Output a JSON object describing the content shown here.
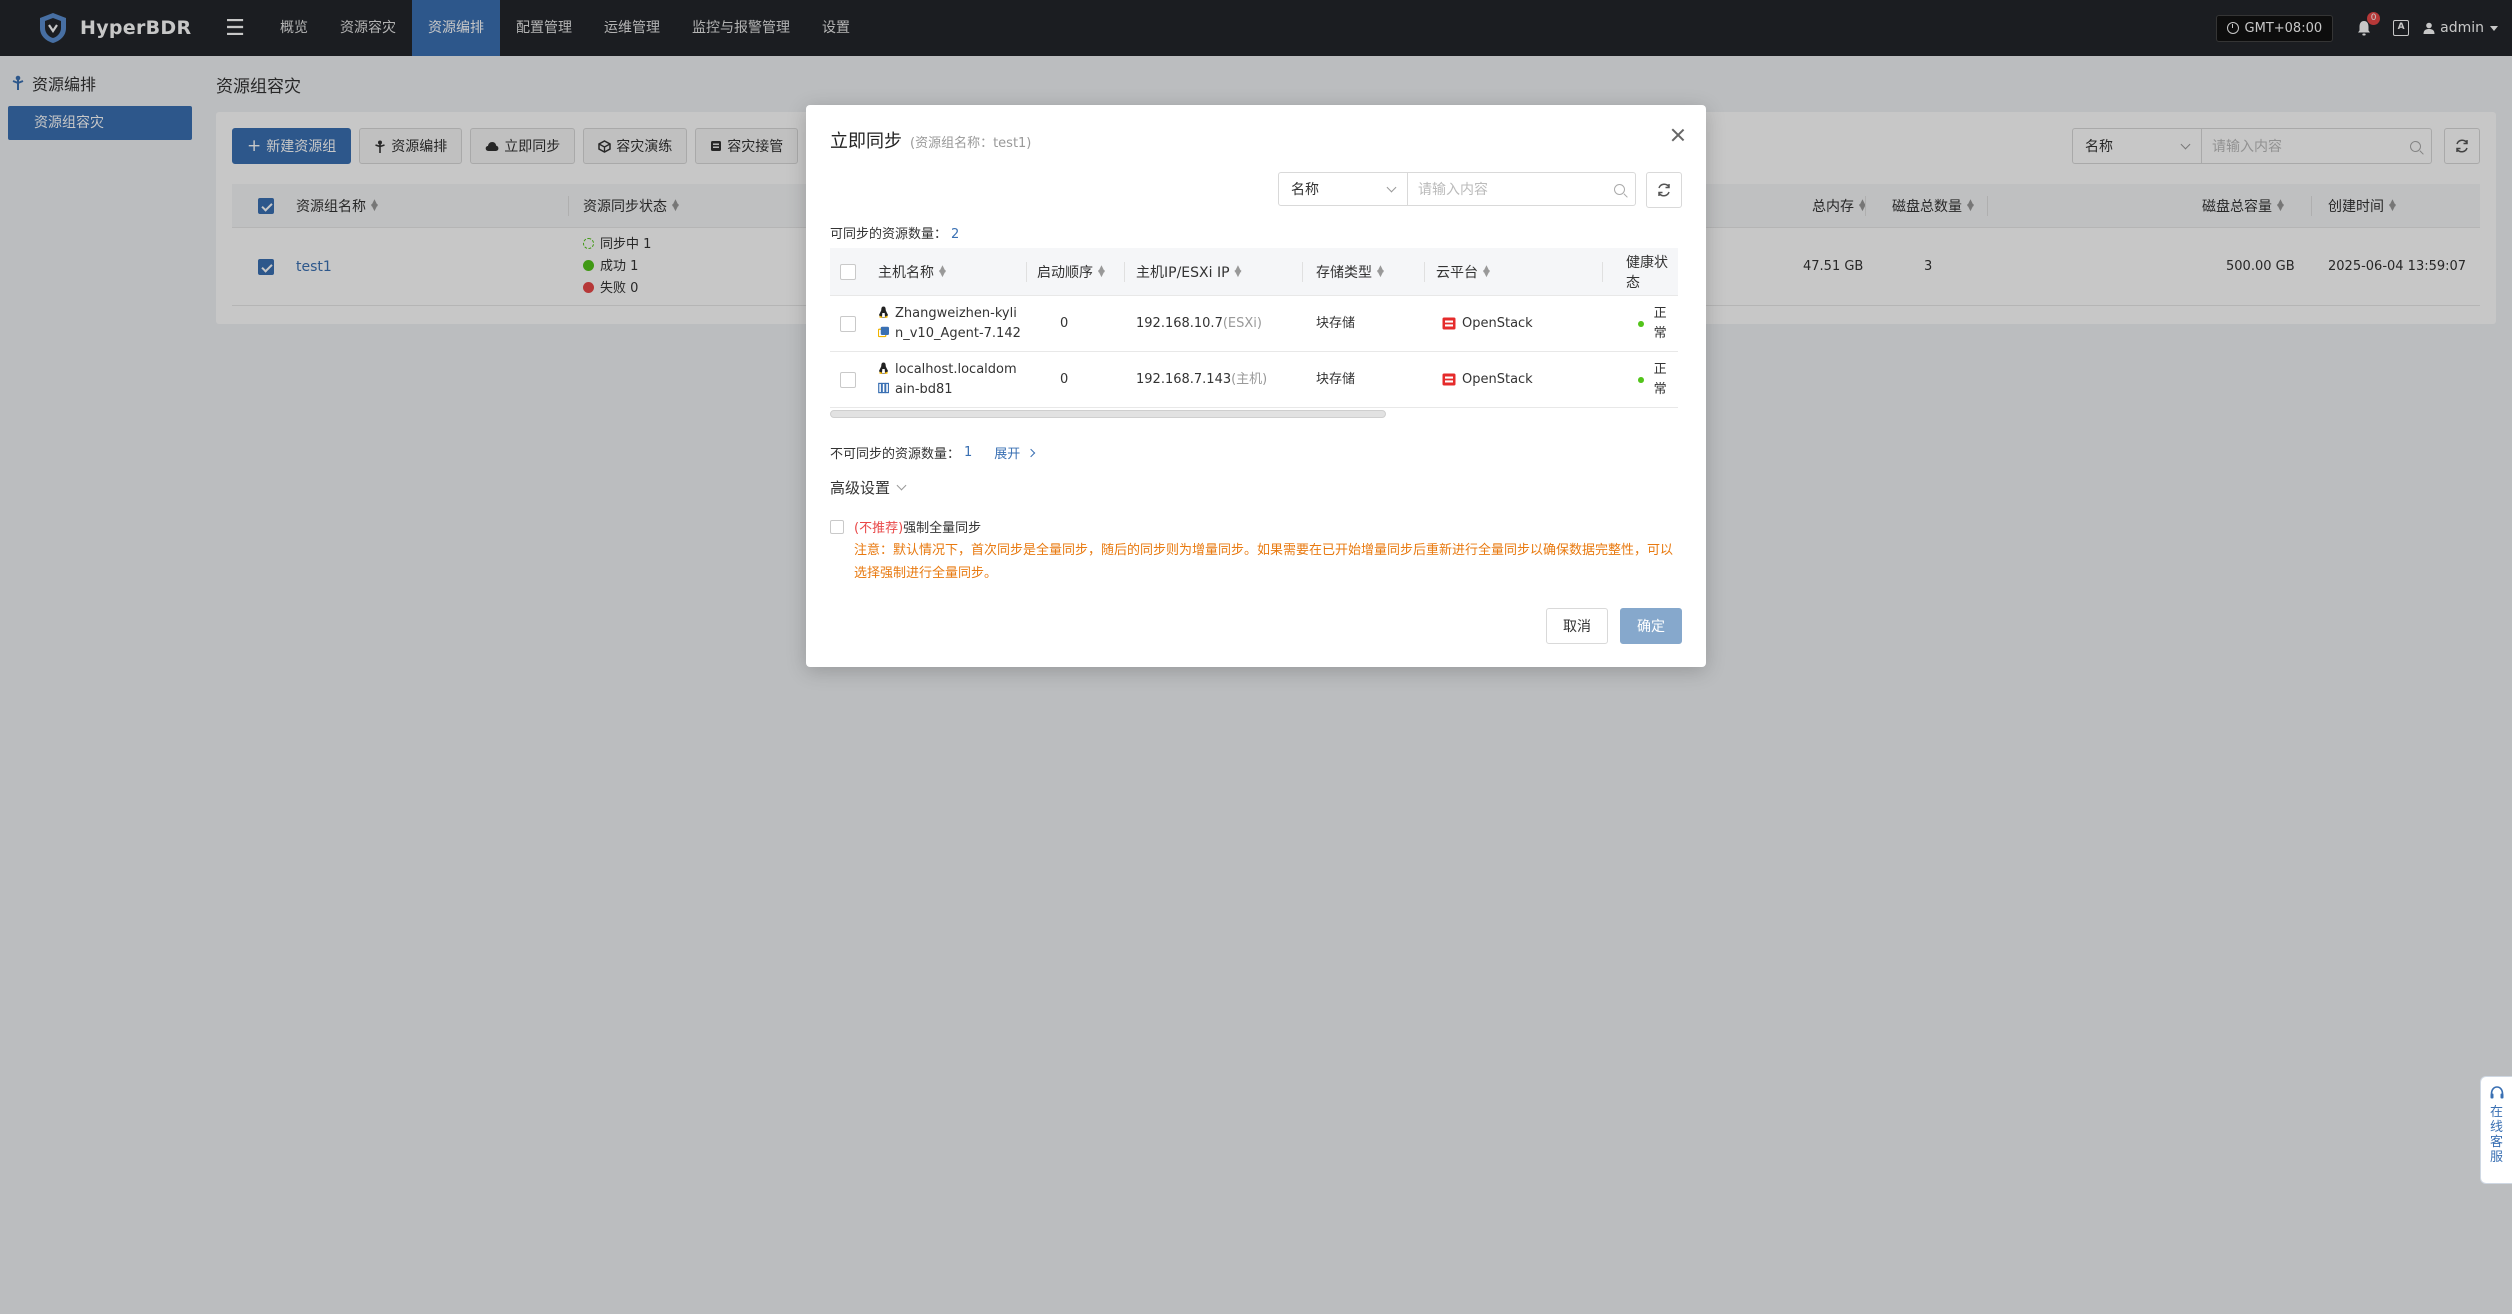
{
  "app": {
    "brand": "HyperBDR",
    "menu": [
      "概览",
      "资源容灾",
      "资源编排",
      "配置管理",
      "运维管理",
      "监控与报警管理",
      "设置"
    ],
    "active_menu_index": 2,
    "timezone": "GMT+08:00",
    "notification_count": "0",
    "lang_glyph": "A",
    "user": "admin"
  },
  "sidebar": {
    "section": "资源编排",
    "items": [
      "资源组容灾"
    ]
  },
  "page": {
    "title": "资源组容灾",
    "toolbar": {
      "new_group": "新建资源组",
      "orchestrate": "资源编排",
      "sync_now": "立即同步",
      "drill": "容灾演练",
      "takeover": "容灾接管"
    },
    "search": {
      "field": "名称",
      "placeholder": "请输入内容"
    },
    "table": {
      "headers": {
        "name": "资源组名称",
        "sync_status": "资源同步状态",
        "total_memory": "总内存",
        "disk_count": "磁盘总数量",
        "disk_capacity": "磁盘总容量",
        "created": "创建时间"
      },
      "rows": [
        {
          "name": "test1",
          "status_syncing": "同步中 1",
          "status_success": "成功 1",
          "status_fail": "失败 0",
          "total_memory": "47.51 GB",
          "disk_count": "3",
          "disk_capacity": "500.00 GB",
          "created": "2025-06-04 13:59:07"
        }
      ]
    }
  },
  "modal": {
    "title": "立即同步",
    "subtitle": "(资源组名称：test1)",
    "search": {
      "field": "名称",
      "placeholder": "请输入内容"
    },
    "syncable_label": "可同步的资源数量：",
    "syncable_count": "2",
    "headers": {
      "host": "主机名称",
      "boot_order": "启动顺序",
      "host_ip": "主机IP/ESXi IP",
      "storage": "存储类型",
      "cloud": "云平台",
      "health": "健康状态"
    },
    "rows": [
      {
        "host_line1": "Zhangweizhen-kyli",
        "host_line2": "n_v10_Agent-7.142",
        "boot_order": "0",
        "ip": "192.168.10.7",
        "ip_tag": "(ESXi)",
        "storage": "块存储",
        "cloud": "OpenStack",
        "health": "正常"
      },
      {
        "host_line1": "localhost.localdom",
        "host_line2": "ain-bd81",
        "boot_order": "0",
        "ip": "192.168.7.143",
        "ip_tag": "(主机)",
        "storage": "块存储",
        "cloud": "OpenStack",
        "health": "正常"
      }
    ],
    "unsyncable_label": "不可同步的资源数量：",
    "unsyncable_count": "1",
    "expand": "展开",
    "advanced": "高级设置",
    "force_tag": "(不推荐)",
    "force_label": "强制全量同步",
    "note": "注意：默认情况下，首次同步是全量同步，随后的同步则为增量同步。如果需要在已开始增量同步后重新进行全量同步以确保数据完整性，可以选择强制进行全量同步。",
    "cancel": "取消",
    "confirm": "确定"
  },
  "service_tab": [
    "在",
    "线",
    "客",
    "服"
  ],
  "colors": {
    "brand_blue": "#3a70b3",
    "nav_bg": "#23262b",
    "warning_orange": "#e8790f",
    "danger_red": "#e94848",
    "success_green": "#52c41a"
  }
}
